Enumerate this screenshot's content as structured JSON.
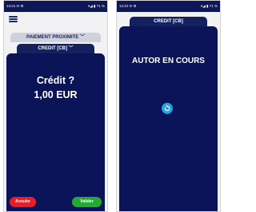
{
  "left_screen": {
    "status": {
      "time": "13:21",
      "icons": "✉ ⚙",
      "right": "▾◢ ▮ 71 %"
    },
    "menu_icon": "hamburger-icon",
    "tab_proximite": {
      "label": "PAIEMENT PROXIMITE ﹀"
    },
    "tab_credit": {
      "label": "CREDIT [CB] ﹀"
    },
    "credit_prompt": "Crédit ?",
    "credit_amount": "1,00 EUR",
    "cancel_label": "Annuler",
    "validate_label": "Valider"
  },
  "right_screen": {
    "status": {
      "time": "13:22",
      "icons": "✉ ⚙",
      "right": "▾◢ ▮ 71 %"
    },
    "tab_credit": {
      "label": "CREDIT [CB]"
    },
    "status_message": "AUTOR EN COURS",
    "spinner_icon": "loading-spinner-icon"
  },
  "colors": {
    "navy": "#0c1459",
    "tab_grey": "#cfd1dc",
    "cancel": "#e61e2c",
    "validate": "#25a836",
    "spinner": "#1fa6e0"
  }
}
